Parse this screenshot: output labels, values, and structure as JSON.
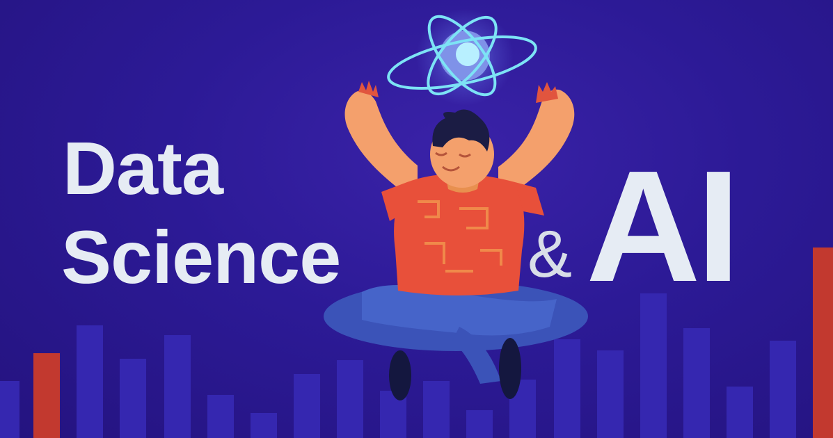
{
  "banner": {
    "title_line1": "Data",
    "title_line2": "Science",
    "ampersand": "&",
    "title_accent": "AI"
  },
  "colors": {
    "background": "#2c1a96",
    "bar_blue": "#3527b0",
    "bar_red": "#c2392f",
    "title_text": "#e6ecf4",
    "shirt": "#e8503a",
    "pants": "#3b53b8",
    "atom_glow": "#7de3f5"
  },
  "icons": [
    "atom-icon"
  ]
}
